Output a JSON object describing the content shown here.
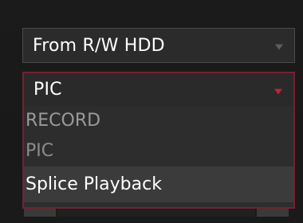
{
  "playback": {
    "source_select": {
      "value": "From R/W HDD",
      "arrow_icon": "dropdown-arrow-icon"
    },
    "type_select": {
      "value": "PIC",
      "arrow_icon": "dropdown-arrow-icon",
      "options": [
        "RECORD",
        "PIC",
        "Splice Playback"
      ],
      "highlighted_option": "Splice Playback"
    }
  },
  "colors": {
    "background": "#1a1a1a",
    "select_background": "#2b2b2b",
    "focus_border": "#7a1e33",
    "arrow_active": "#c0242f",
    "option_text": "#8c8c8c",
    "option_hover_background": "#3b3b3b",
    "text": "#ffffff"
  }
}
